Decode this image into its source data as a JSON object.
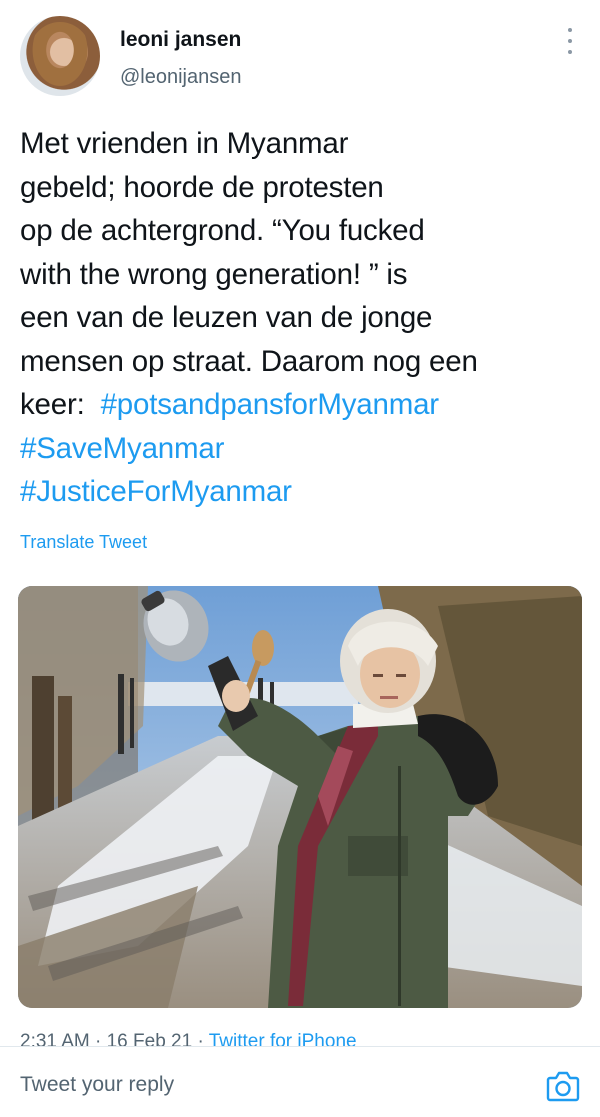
{
  "author": {
    "display_name": "leoni jansen",
    "handle": "@leonijansen"
  },
  "tweet": {
    "lines": [
      {
        "text": "Met vrienden in Myanmar"
      },
      {
        "text": "gebeld;  hoorde de protesten"
      },
      {
        "text": "op de achtergrond. “You fucked"
      },
      {
        "text": "with the wrong generation! ” is"
      },
      {
        "text": "een van de leuzen van de jonge"
      },
      {
        "text": "mensen op straat. Daarom nog een"
      },
      {
        "text": "keer:  ",
        "hashtag": "#potsandpansforMyanmar"
      },
      {
        "hashtag": "#SaveMyanmar"
      },
      {
        "hashtag": "#JusticeForMyanmar"
      }
    ],
    "translate_label": "Translate Tweet"
  },
  "meta": {
    "time": "2:31 AM",
    "separator": " · ",
    "date": "16 Feb 21",
    "client": "Twitter for iPhone"
  },
  "reply": {
    "placeholder": "Tweet your reply"
  },
  "icons": {
    "more": "more-vertical-icon",
    "camera": "camera-icon"
  },
  "colors": {
    "accent": "#1d9bf0",
    "text": "#0f1419",
    "secondary": "#536471"
  }
}
